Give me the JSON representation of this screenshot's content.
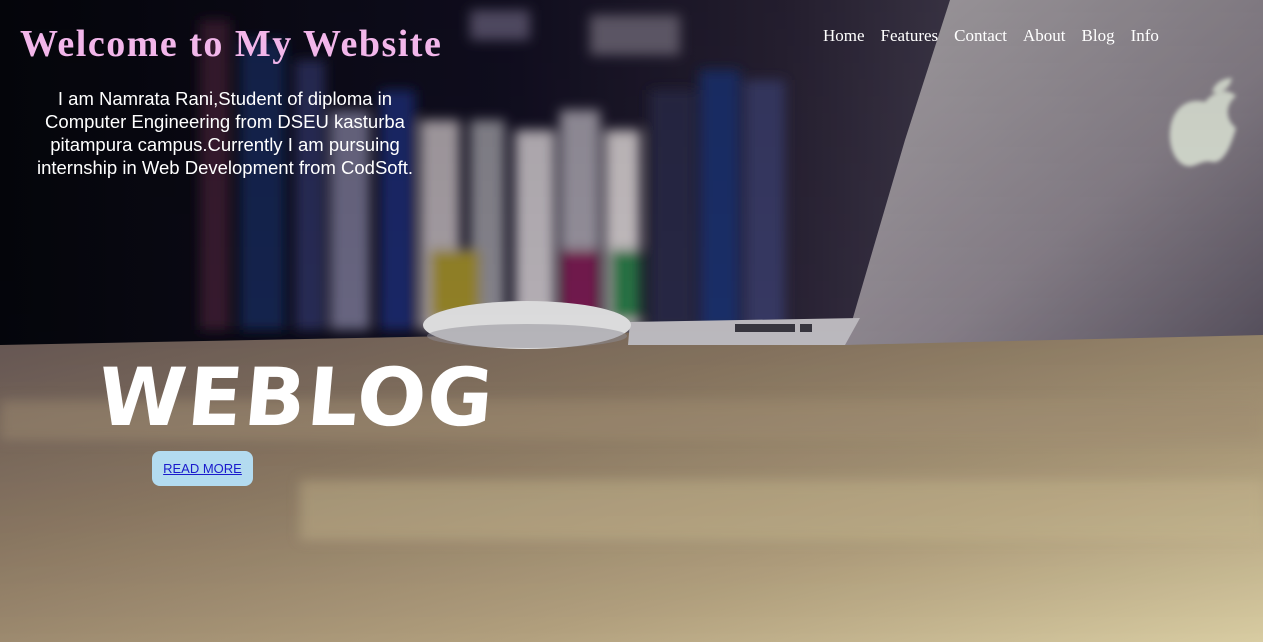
{
  "header": {
    "title": "Welcome to My Website"
  },
  "nav": {
    "items": [
      "Home",
      "Features",
      "Contact",
      "About",
      "Blog",
      "Info"
    ]
  },
  "intro": {
    "text": "I am Namrata Rani,Student of diploma in Computer Engineering from DSEU kasturba pitampura campus.Currently I am pursuing internship in Web Development from CodSoft."
  },
  "hero": {
    "word": "WEBLOG",
    "button_label": "READ MORE"
  },
  "colors": {
    "title": "#f2b6ea",
    "button_bg": "#b3dbf0",
    "link": "#1a1acc"
  },
  "icons": {
    "laptop_logo": "apple-logo-icon"
  }
}
